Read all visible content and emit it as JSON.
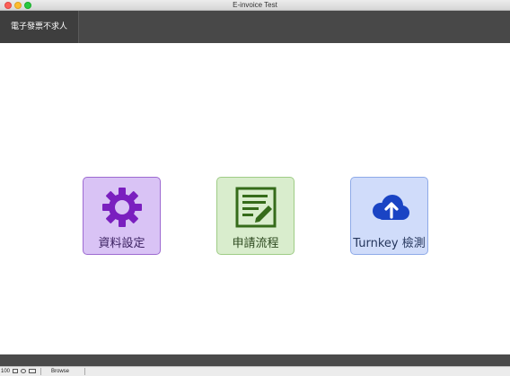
{
  "window": {
    "title": "E-invoice Test"
  },
  "toolbar": {
    "app_tab_label": "電子發票不求人"
  },
  "tiles": [
    {
      "label": "資料設定",
      "icon": "gear-icon",
      "color": "#7a1fbf"
    },
    {
      "label": "申請流程",
      "icon": "edit-form-icon",
      "color": "#356b1a"
    },
    {
      "label": "Turnkey 檢測",
      "icon": "cloud-upload-icon",
      "color": "#1a44c4"
    }
  ],
  "statusbar": {
    "zoom": "100",
    "mode": "Browse"
  }
}
